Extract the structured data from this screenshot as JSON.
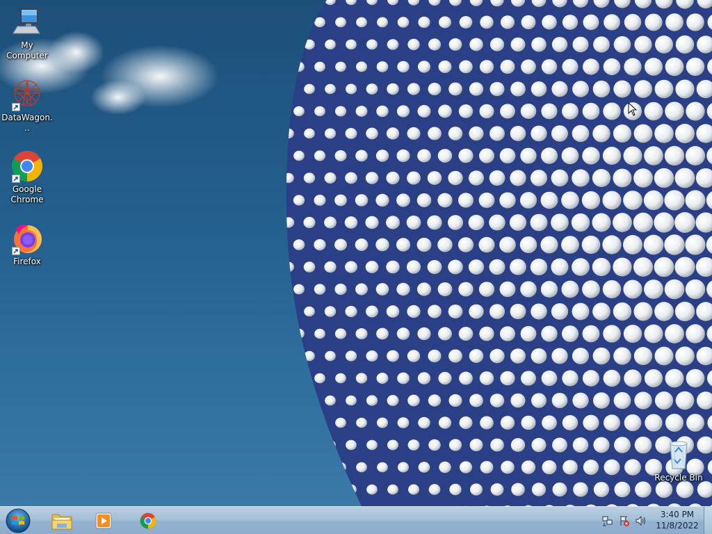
{
  "desktop": {
    "icons": [
      {
        "label": "My Computer",
        "icon": "computer-icon"
      },
      {
        "label": "DataWagon...",
        "icon": "datawagon-icon",
        "shortcut": true
      },
      {
        "label": "Google Chrome",
        "icon": "chrome-icon",
        "shortcut": true
      },
      {
        "label": "Firefox",
        "icon": "firefox-icon",
        "shortcut": true
      },
      {
        "label": "Recycle Bin",
        "icon": "recycle-bin-icon"
      }
    ],
    "wallpaper": "sky-with-dotted-dome"
  },
  "taskbar": {
    "start": {
      "icon": "windows-start-orb"
    },
    "pinned": [
      {
        "name": "File Explorer",
        "icon": "folder-icon"
      },
      {
        "name": "Media Player",
        "icon": "media-player-icon"
      },
      {
        "name": "Google Chrome",
        "icon": "chrome-icon"
      }
    ],
    "tray": [
      {
        "icon": "network-icon"
      },
      {
        "icon": "action-center-icon"
      },
      {
        "icon": "volume-icon"
      }
    ],
    "clock": {
      "time": "3:40 PM",
      "date": "11/8/2022"
    }
  },
  "colors": {
    "sky": "#24608f",
    "taskbar": "#a6c0d8",
    "label_text": "#ffffff"
  }
}
